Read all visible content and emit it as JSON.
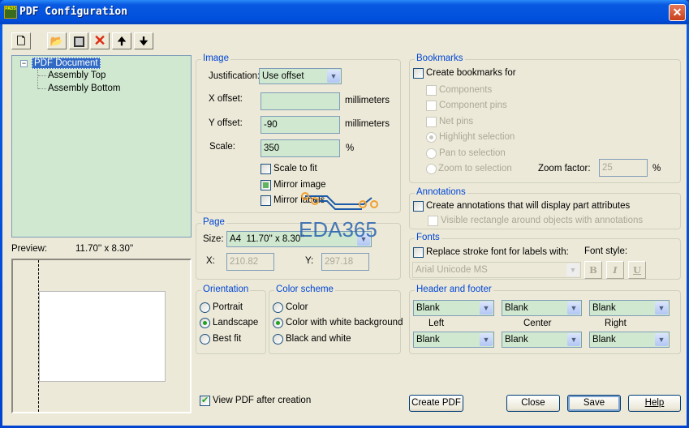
{
  "window": {
    "title": "PDF Configuration",
    "app_icon_text": "PADS"
  },
  "toolbar": {
    "new": "new-icon",
    "open": "open-folder-icon",
    "save": "save-icon",
    "delete": "delete-icon",
    "up": "arrow-up-icon",
    "down": "arrow-down-icon"
  },
  "tree": {
    "root": "PDF Document",
    "children": [
      "Assembly Top",
      "Assembly Bottom"
    ]
  },
  "preview": {
    "label": "Preview:",
    "size": "11.70'' x 8.30''"
  },
  "image": {
    "legend": "Image",
    "justification_label": "Justification:",
    "justification_value": "Use offset",
    "x_offset_label": "X offset:",
    "x_offset_value": "",
    "x_unit": "millimeters",
    "y_offset_label": "Y offset:",
    "y_offset_value": "-90",
    "y_unit": "millimeters",
    "scale_label": "Scale:",
    "scale_value": "350",
    "scale_unit": "%",
    "scale_to_fit": "Scale to fit",
    "mirror_image": "Mirror image",
    "mirror_labels": "Mirror labels"
  },
  "page": {
    "legend": "Page",
    "size_label": "Size:",
    "size_value": "A4  11.70'' x 8.30''",
    "x_label": "X:",
    "x_value": "210.82",
    "y_label": "Y:",
    "y_value": "297.18"
  },
  "orientation": {
    "legend": "Orientation",
    "options": [
      "Portrait",
      "Landscape",
      "Best fit"
    ],
    "selected": "Landscape"
  },
  "color_scheme": {
    "legend": "Color scheme",
    "options": [
      "Color",
      "Color with white background",
      "Black and white"
    ],
    "selected": "Color with white background"
  },
  "view_pdf": {
    "label": "View PDF after creation",
    "checked": true
  },
  "bookmarks": {
    "legend": "Bookmarks",
    "create": "Create bookmarks for",
    "components": "Components",
    "component_pins": "Component pins",
    "net_pins": "Net pins",
    "highlight": "Highlight selection",
    "pan": "Pan to selection",
    "zoom": "Zoom to selection",
    "zoom_factor_label": "Zoom factor:",
    "zoom_factor_value": "25",
    "zoom_unit": "%"
  },
  "annotations": {
    "legend": "Annotations",
    "create": "Create annotations that will display part attributes",
    "visible_rect": "Visible rectangle around objects with annotations"
  },
  "fonts": {
    "legend": "Fonts",
    "replace": "Replace stroke font for labels with:",
    "font_value": "Arial Unicode MS",
    "style_label": "Font style:",
    "bold": "B",
    "italic": "I",
    "underline": "U"
  },
  "header_footer": {
    "legend": "Header and footer",
    "header": [
      "Blank",
      "Blank",
      "Blank"
    ],
    "footer": [
      "Blank",
      "Blank",
      "Blank"
    ],
    "left": "Left",
    "center": "Center",
    "right": "Right"
  },
  "buttons": {
    "create_pdf": "Create PDF",
    "close": "Close",
    "save": "Save",
    "help": "Help"
  },
  "watermark": "EDA365"
}
